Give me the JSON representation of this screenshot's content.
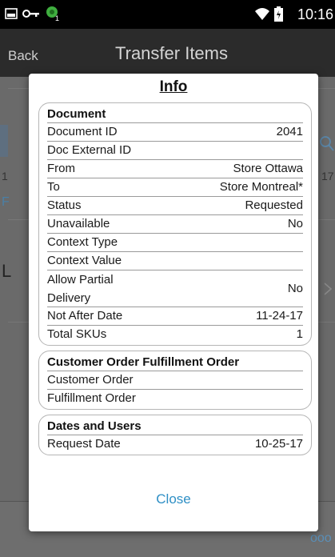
{
  "status_bar": {
    "time": "10:16",
    "icons": [
      "gallery-icon",
      "key-icon",
      "android-notification-icon",
      "wifi-icon",
      "battery-icon"
    ]
  },
  "action_bar": {
    "back_label": "Back",
    "title": "Transfer Items"
  },
  "background": {
    "frag_1": "1",
    "frag_2": "17",
    "frag_3": "F",
    "frag_4": "ooo"
  },
  "dialog": {
    "title": "Info",
    "close_label": "Close",
    "document": {
      "header": "Document",
      "rows": [
        {
          "label": "Document ID",
          "value": "2041"
        },
        {
          "label": "Doc External ID",
          "value": ""
        },
        {
          "label": "From",
          "value": "Store Ottawa"
        },
        {
          "label": "To",
          "value": "Store Montreal*"
        },
        {
          "label": "Status",
          "value": "Requested"
        },
        {
          "label": "Unavailable",
          "value": "No"
        },
        {
          "label": "Context Type",
          "value": ""
        },
        {
          "label": "Context Value",
          "value": ""
        },
        {
          "label": "Allow Partial Delivery",
          "value": "No"
        },
        {
          "label": "Not After Date",
          "value": "11-24-17"
        },
        {
          "label": "Total SKUs",
          "value": "1"
        }
      ]
    },
    "customer_order": {
      "header": "Customer Order Fulfillment Order",
      "rows": [
        {
          "label": "Customer Order",
          "value": ""
        },
        {
          "label": "Fulfillment Order",
          "value": ""
        }
      ]
    },
    "dates_users": {
      "header": "Dates and Users",
      "rows": [
        {
          "label": "Request Date",
          "value": "10-25-17"
        }
      ]
    }
  }
}
